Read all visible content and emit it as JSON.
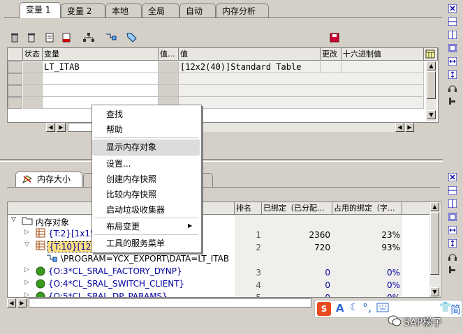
{
  "top_tabs": [
    "变量 1",
    "变量 2",
    "本地",
    "全局",
    "自动",
    "内存分析"
  ],
  "variables_table": {
    "headers": [
      "状态",
      "变量",
      "值...",
      "值",
      "更改",
      "十六进制值"
    ],
    "rows": [
      {
        "variable": "LT_ITAB",
        "value": "[12x2(40)]Standard Table"
      }
    ]
  },
  "bottom_tabs": [
    "内存大小"
  ],
  "memory_table": {
    "headers": [
      "",
      "排名",
      "已绑定（已分配...",
      "占用的绑定（字..."
    ],
    "root_label": "内存对象",
    "rows": [
      {
        "label": "{T:2}[1x15",
        "rank": "1",
        "bound": "2360",
        "pct": "23%"
      },
      {
        "label": "{T:10}[12x",
        "rank": "2",
        "bound": "720",
        "pct": "93%"
      },
      {
        "label": "\\PROGRAM=YCX_EXPORT\\DATA=LT_ITAB",
        "rank": "",
        "bound": "",
        "pct": ""
      },
      {
        "label": "{O:3*CL_SRAL_FACTORY_DYNP}",
        "rank": "3",
        "bound": "0",
        "pct": "0%"
      },
      {
        "label": "{O:4*CL_SRAL_SWITCH_CLIENT}",
        "rank": "4",
        "bound": "0",
        "pct": "0%"
      },
      {
        "label": "{O:5*CL_SRAL_DP_PARAMS}",
        "rank": "5",
        "bound": "0",
        "pct": "0%"
      }
    ]
  },
  "context_menu": {
    "items": [
      "查找",
      "帮助",
      "显示内存对象",
      "设置...",
      "创建内存快照",
      "比较内存快照",
      "启动垃圾收集器",
      "布局变更",
      "工具的服务菜单"
    ],
    "highlighted_index": 2
  },
  "ime_bar": {
    "logo": "S",
    "labels": [
      "A",
      "简"
    ]
  },
  "watermark": "SAP梯子",
  "colors": {
    "accent_blue": "#0000a0",
    "selected_yellow": "#ffe080",
    "object_green": "#3a9a1c"
  }
}
